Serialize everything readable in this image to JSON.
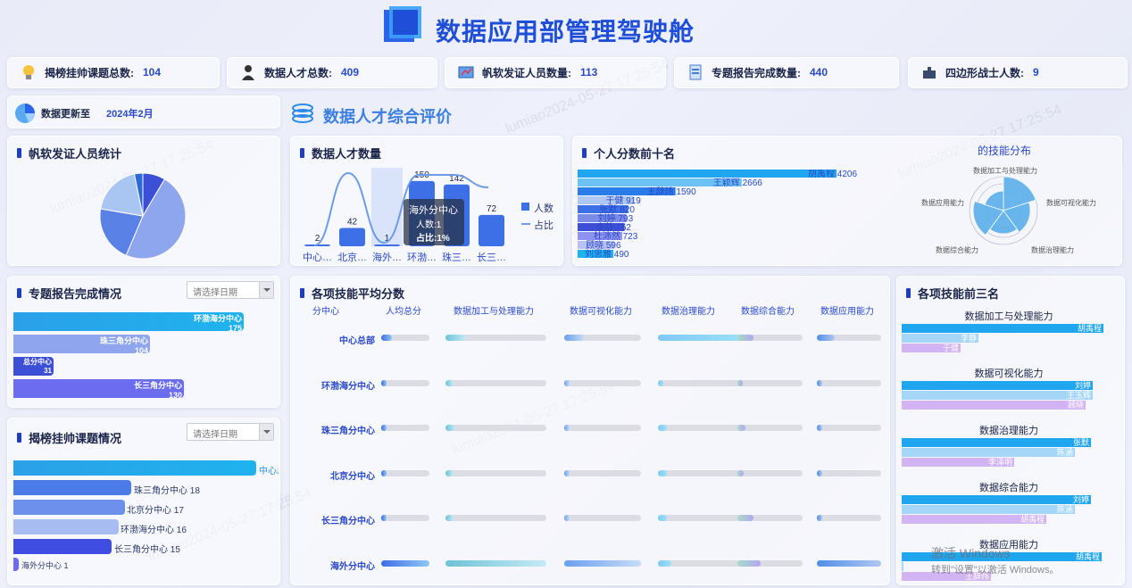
{
  "header": {
    "title": "数据应用部管理驾驶舱"
  },
  "kpis": [
    {
      "label": "揭榜挂帅课题总数:",
      "value": "104",
      "icon": "lightbulb-icon"
    },
    {
      "label": "数据人才总数:",
      "value": "409",
      "icon": "person-icon"
    },
    {
      "label": "帆软发证人员数量:",
      "value": "113",
      "icon": "certificate-icon"
    },
    {
      "label": "专题报告完成数量:",
      "value": "440",
      "icon": "report-icon"
    },
    {
      "label": "四边形战士人数:",
      "value": "9",
      "icon": "puzzle-icon"
    }
  ],
  "update": {
    "label": "数据更新至",
    "value": "2024年2月"
  },
  "section_title": "数据人才综合评价",
  "fanruan": {
    "title": "帆软发证人员统计"
  },
  "topic_report": {
    "title": "专题报告完成情况",
    "placeholder": "请选择日期",
    "items": [
      {
        "name": "环渤海分中心",
        "value": "175"
      },
      {
        "name": "珠三角分中心",
        "value": "104"
      },
      {
        "name": "总分中心",
        "value": "31"
      },
      {
        "name": "长三角分中心",
        "value": "130"
      }
    ]
  },
  "jiebang": {
    "title": "揭榜挂帅课题情况",
    "placeholder": "请选择日期",
    "items": [
      {
        "name": "中心总部",
        "value": ""
      },
      {
        "name": "珠三角分中心",
        "value": "18"
      },
      {
        "name": "北京分中心",
        "value": "17"
      },
      {
        "name": "环渤海分中心",
        "value": "16"
      },
      {
        "name": "长三角分中心",
        "value": "15"
      },
      {
        "name": "海外分中心",
        "value": "1"
      }
    ]
  },
  "talent_count": {
    "title": "数据人才数量",
    "legend_bar": "人数",
    "legend_line": "占比",
    "tooltip": {
      "title": "海外分中心",
      "line1": "人数:1",
      "line2": "占比:1%"
    }
  },
  "top10": {
    "title": "个人分数前十名"
  },
  "skill_dist": {
    "title": "的技能分布",
    "labels": [
      "数据加工与处理能力",
      "数据可视化能力",
      "数据治理能力",
      "数据综合能力",
      "数据应用能力"
    ]
  },
  "skill_avg": {
    "title": "各项技能平均分数",
    "columns": [
      "分中心",
      "人均总分",
      "数据加工与处理能力",
      "数据可视化能力",
      "数据治理能力",
      "数据综合能力",
      "数据应用能力"
    ],
    "rows": [
      "中心总部",
      "环渤海分中心",
      "珠三角分中心",
      "北京分中心",
      "长三角分中心",
      "海外分中心"
    ]
  },
  "top3": {
    "title": "各项技能前三名",
    "groups": [
      {
        "name": "数据加工与处理能力",
        "people": [
          "胡禹程",
          "李静",
          "于健"
        ]
      },
      {
        "name": "数据可视化能力",
        "people": [
          "刘婷",
          "王玉辉",
          "顾晓"
        ]
      },
      {
        "name": "数据治理能力",
        "people": [
          "张默",
          "陈涵",
          "李泽明"
        ]
      },
      {
        "name": "数据综合能力",
        "people": [
          "刘婷",
          "陈涵",
          "胡禹程"
        ]
      },
      {
        "name": "数据应用能力",
        "people": [
          "胡禹程",
          "",
          "王辞炜"
        ]
      }
    ]
  },
  "activation": {
    "line1": "激活 Windows",
    "line2": "转到\"设置\"以激活 Windows。"
  },
  "chart_data": [
    {
      "type": "pie",
      "name": "帆软发证人员统计",
      "slices": [
        {
          "value": 8,
          "color": "#3d4fd6"
        },
        {
          "value": 45,
          "color": "#8da6ee"
        },
        {
          "value": 20,
          "color": "#5a82e6"
        },
        {
          "value": 18,
          "color": "#a9c6f3"
        },
        {
          "value": 3,
          "color": "#2a6bd9"
        }
      ]
    },
    {
      "type": "bar",
      "name": "数据人才数量",
      "categories": [
        "中心…",
        "北京…",
        "海外…",
        "环渤…",
        "珠三…",
        "长三…"
      ],
      "values": [
        2,
        42,
        1,
        150,
        142,
        72
      ],
      "ylim": [
        0,
        160
      ]
    },
    {
      "type": "bar",
      "name": "个人分数前十名",
      "orientation": "horizontal",
      "categories": [
        "胡禹程",
        "王颖辉",
        "王辞炜",
        "于健",
        "张默",
        "刘婷",
        "李静",
        "杜沛然",
        "顾晓",
        "刘思雅"
      ],
      "values": [
        4206,
        2666,
        1590,
        919,
        820,
        793,
        762,
        723,
        596,
        490
      ]
    },
    {
      "type": "table",
      "name": "各项技能平均分数",
      "fractions": [
        [
          0.22,
          0.2,
          0.25,
          1.0,
          0.25,
          0.28
        ],
        [
          0.05,
          0.08,
          0.04,
          0.03,
          0.03,
          0.03
        ],
        [
          0.06,
          0.1,
          0.06,
          0.1,
          0.12,
          0.05
        ],
        [
          0.06,
          0.08,
          0.06,
          0.1,
          0.1,
          0.05
        ],
        [
          0.06,
          0.08,
          0.06,
          0.1,
          0.25,
          0.05
        ],
        [
          1.0,
          1.0,
          1.0,
          0.15,
          0.35,
          1.0
        ]
      ]
    }
  ]
}
